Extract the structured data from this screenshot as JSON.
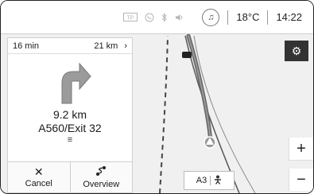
{
  "status": {
    "temperature": "18°C",
    "time": "14:22",
    "icons": [
      "tp-icon",
      "phone-icon",
      "bluetooth-icon",
      "volume-icon"
    ]
  },
  "guidance": {
    "remaining_time": "16 min",
    "remaining_distance": "21 km",
    "next_chevron": "›",
    "maneuver_distance": "9.2 km",
    "maneuver_road": "A560/Exit 32",
    "list_icon": "≡"
  },
  "buttons": {
    "cancel_label": "Cancel",
    "cancel_icon": "✕",
    "overview_label": "Overview",
    "overview_icon": "ఽ"
  },
  "map": {
    "zoom_in": "+",
    "zoom_out": "−",
    "road_sign": "A3",
    "road_sign_icon": "person-icon",
    "settings_icon": "gear-icon"
  }
}
